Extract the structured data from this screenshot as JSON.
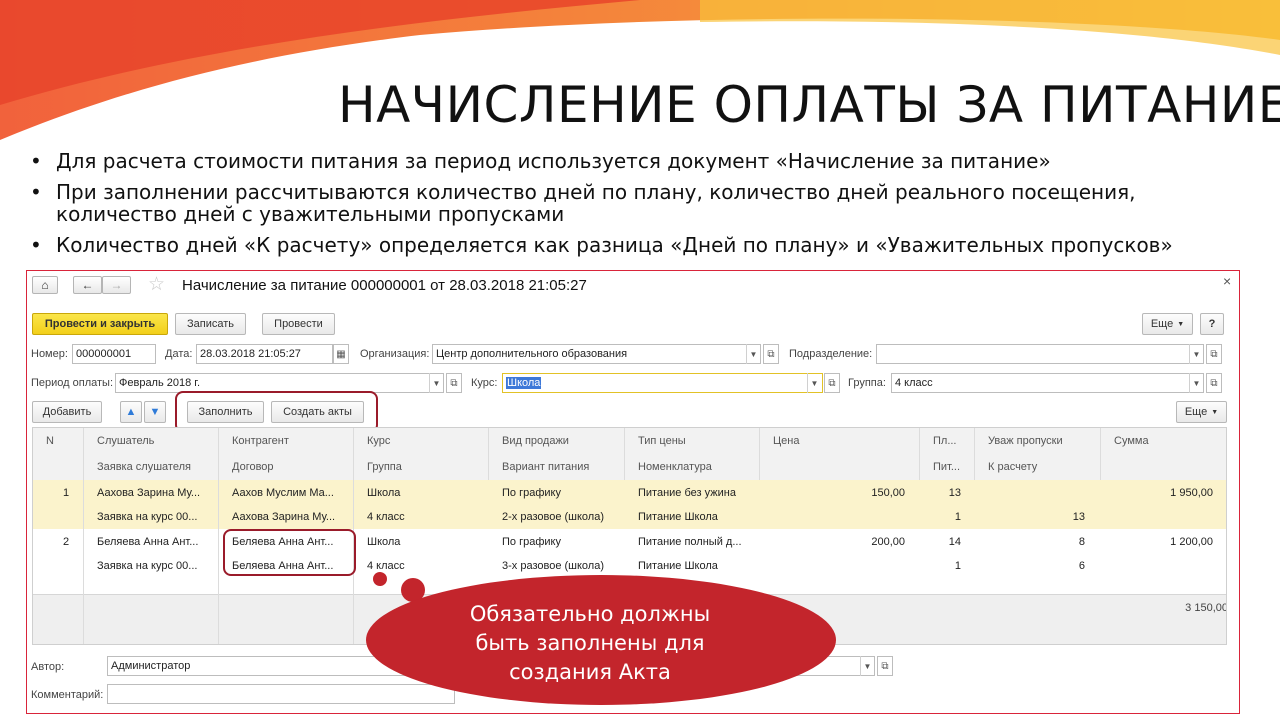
{
  "slide": {
    "title": "НАЧИСЛЕНИЕ ОПЛАТЫ ЗА ПИТАНИЕ",
    "bullets": [
      "Для расчета стоимости питания за период используется документ «Начисление за питание»",
      "При заполнении рассчитываются количество дней по плану, количество дней реального посещения, количество дней с уважительными пропусками",
      "Количество дней «К расчету» определяется как разница «Дней по плану» и «Уважительных пропусков»"
    ]
  },
  "window": {
    "title": "Начисление за питание 000000001 от 28.03.2018 21:05:27",
    "close": "×",
    "toolbar": {
      "post_close": "Провести и закрыть",
      "save": "Записать",
      "post": "Провести",
      "more": "Еще",
      "help": "?"
    },
    "form": {
      "number_label": "Номер:",
      "number": "000000001",
      "date_label": "Дата:",
      "date": "28.03.2018 21:05:27",
      "org_label": "Организация:",
      "org": "Центр дополнительного образования",
      "dept_label": "Подразделение:",
      "dept": "",
      "period_label": "Период оплаты:",
      "period": "Февраль 2018 г.",
      "course_label": "Курс:",
      "course": "Школа",
      "group_label": "Группа:",
      "group": "4 класс"
    },
    "table_toolbar": {
      "add": "Добавить",
      "fill": "Заполнить",
      "create_acts": "Создать акты",
      "more": "Еще"
    },
    "table": {
      "headers_top": [
        "N",
        "Слушатель",
        "Контрагент",
        "Курс",
        "Вид продажи",
        "Тип цены",
        "Цена",
        "Пл...",
        "Уваж пропуски",
        "Сумма"
      ],
      "headers_bottom": [
        "",
        "Заявка слушателя",
        "Договор",
        "Группа",
        "Вариант питания",
        "Номенклатура",
        "",
        "Пит...",
        "К расчету",
        ""
      ],
      "rows": [
        {
          "n": "1",
          "student": "Аахова Зарина Му...",
          "contractor": "Аахов Муслим Ма...",
          "course": "Школа",
          "sale_type": "По графику",
          "price_type": "Питание без ужина",
          "price": "150,00",
          "plan": "13",
          "excused": "",
          "sum": "1 950,00",
          "application": "Заявка на курс 00...",
          "contract": "Аахова Зарина Му...",
          "group": "4 класс",
          "meal_variant": "2-х разовое (школа)",
          "nomenclature": "Питание Школа",
          "meals": "1",
          "to_calc": "13"
        },
        {
          "n": "2",
          "student": "Беляева Анна Ант...",
          "contractor": "Беляева Анна Ант...",
          "course": "Школа",
          "sale_type": "По графику",
          "price_type": "Питание полный д...",
          "price": "200,00",
          "plan": "14",
          "excused": "8",
          "sum": "1 200,00",
          "application": "Заявка на курс 00...",
          "contract": "Беляева Анна Ант...",
          "group": "4 класс",
          "meal_variant": "3-х разовое (школа)",
          "nomenclature": "Питание Школа",
          "meals": "1",
          "to_calc": "6"
        }
      ],
      "total": "3 150,00"
    },
    "bottom": {
      "author_label": "Автор:",
      "author": "Администратор",
      "comment_label": "Комментарий:",
      "comment": ""
    }
  },
  "callout": {
    "text_line1": "Обязательно должны",
    "text_line2": "быть заполнены для",
    "text_line3": "создания Акта"
  },
  "colors": {
    "accent_red": "#c3252c",
    "primary_yellow": "#f2cf1a",
    "row_highlight": "#fbf3cc"
  }
}
